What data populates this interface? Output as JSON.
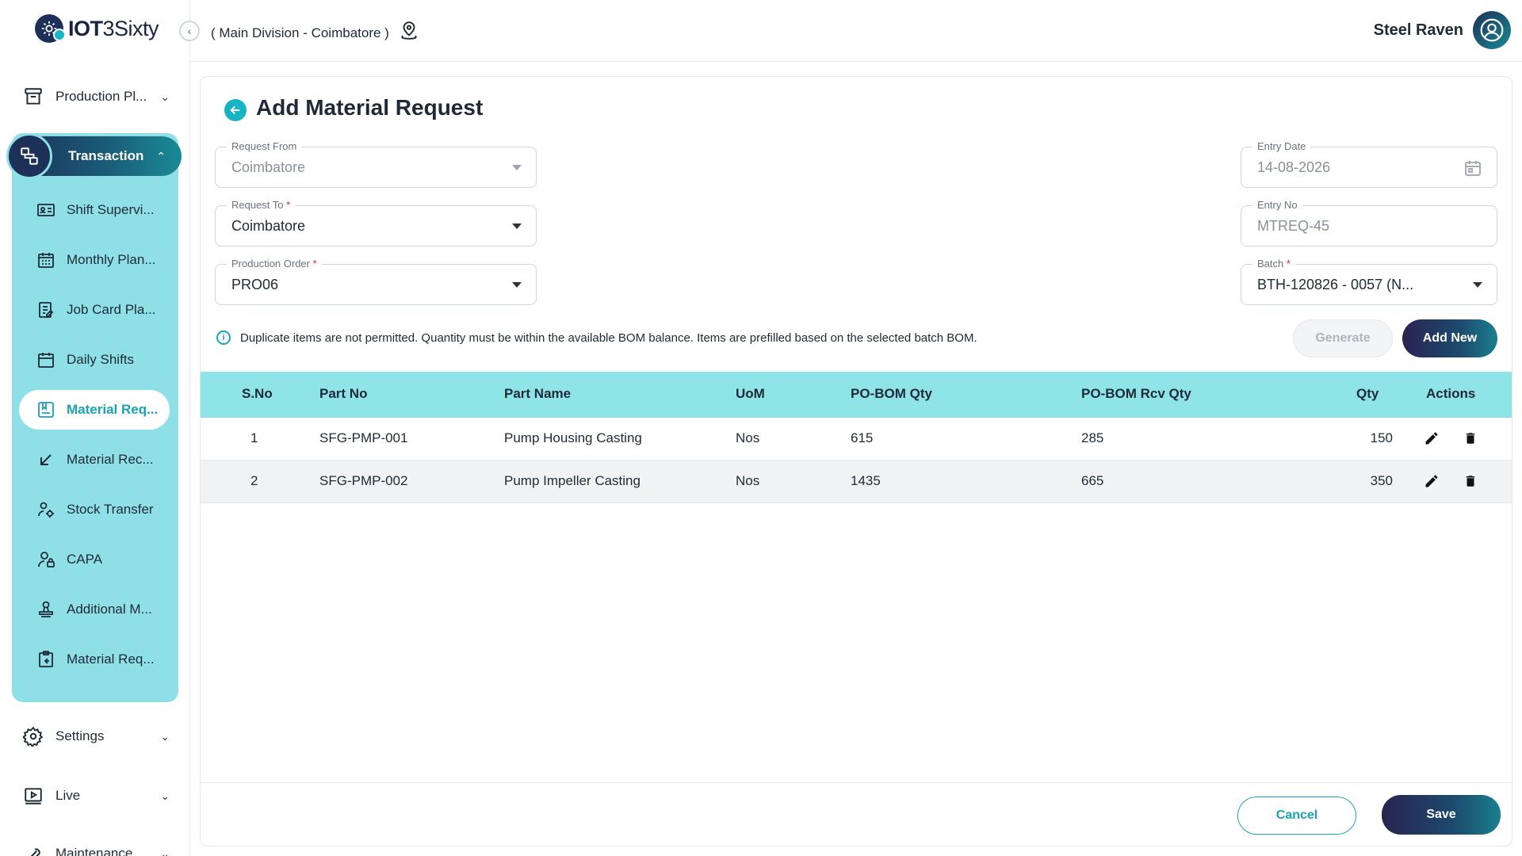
{
  "app": {
    "logo_bold": "IOT",
    "logo_light": "3Sixty"
  },
  "header": {
    "division": "( Main Division - Coimbatore )",
    "user_name": "Steel Raven"
  },
  "sidebar": {
    "production": "Production Pl...",
    "transaction": "Transaction",
    "items": [
      {
        "label": "Shift Supervi...",
        "icon": "id-card-icon"
      },
      {
        "label": "Monthly Plan...",
        "icon": "calendar-grid-icon"
      },
      {
        "label": "Job Card Pla...",
        "icon": "clipboard-edit-icon"
      },
      {
        "label": "Daily Shifts",
        "icon": "calendar-icon"
      },
      {
        "label": "Material Req...",
        "icon": "form-icon"
      },
      {
        "label": "Material Rec...",
        "icon": "arrow-down-left-icon"
      },
      {
        "label": "Stock Transfer",
        "icon": "user-gear-icon"
      },
      {
        "label": "CAPA",
        "icon": "lock-user-icon"
      },
      {
        "label": "Additional M...",
        "icon": "stamp-icon"
      },
      {
        "label": "Material Req...",
        "icon": "clipboard-return-icon"
      }
    ],
    "settings": "Settings",
    "live": "Live",
    "maintenance": "Maintenance"
  },
  "page": {
    "title": "Add Material Request"
  },
  "form": {
    "request_from": {
      "label": "Request From",
      "value": "Coimbatore"
    },
    "request_to": {
      "label": "Request To",
      "required": "*",
      "value": "Coimbatore"
    },
    "production_order": {
      "label": "Production Order",
      "required": "*",
      "value": "PRO06"
    },
    "entry_date": {
      "label": "Entry Date",
      "value": "14-08-2026"
    },
    "entry_no": {
      "label": "Entry No",
      "value": "MTREQ-45"
    },
    "batch": {
      "label": "Batch",
      "required": "*",
      "value": "BTH-120826 - 0057 (N..."
    }
  },
  "info": {
    "message": "Duplicate items are not permitted. Quantity must be within the available BOM balance. Items are prefilled based on the selected batch BOM."
  },
  "buttons": {
    "generate": "Generate",
    "add_new": "Add New",
    "cancel": "Cancel",
    "save": "Save"
  },
  "table": {
    "headers": {
      "sno": "S.No",
      "part_no": "Part No",
      "part_name": "Part Name",
      "uom": "UoM",
      "po_bom_qty": "PO-BOM Qty",
      "po_bom_rcv_qty": "PO-BOM Rcv Qty",
      "qty": "Qty",
      "actions": "Actions"
    },
    "rows": [
      {
        "sno": "1",
        "part_no": "SFG-PMP-001",
        "part_name": "Pump Housing Casting",
        "uom": "Nos",
        "po_bom_qty": "615",
        "po_bom_rcv_qty": "285",
        "qty": "150"
      },
      {
        "sno": "2",
        "part_no": "SFG-PMP-002",
        "part_name": "Pump Impeller Casting",
        "uom": "Nos",
        "po_bom_qty": "1435",
        "po_bom_rcv_qty": "665",
        "qty": "350"
      }
    ]
  },
  "colors": {
    "accent": "#19b4c3",
    "table_header": "#8fe4e8",
    "sidebar_panel": "#8fe0e6",
    "primary_dark": "#1c2f58"
  }
}
